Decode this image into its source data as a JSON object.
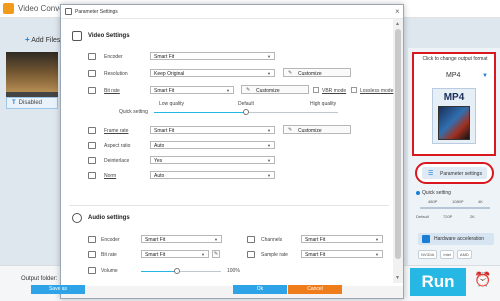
{
  "app": {
    "title": "Video Conve",
    "add_files": "Add Files",
    "subtitle_state": "Disabled",
    "output_folder_label": "Output folder:",
    "run_label": "Run"
  },
  "format_panel": {
    "hint": "Click to change output format",
    "format_name": "MP4",
    "format_icon_text": "MP4",
    "parameter_settings_label": "Parameter settings",
    "quick_setting_label": "Quick setting",
    "quick_top_labels": [
      "480P",
      "1080P",
      "4K"
    ],
    "quick_bottom_labels": [
      "Default",
      "720P",
      "2K"
    ],
    "hardware_accel_label": "Hardware acceleration",
    "vendors": [
      "NVIDIA",
      "Intel",
      "AMD"
    ],
    "accent_color": "#26b7e4",
    "highlight_color": "#d9171e"
  },
  "dialog": {
    "title": "Parameter Settings",
    "video_section": "Video Settings",
    "audio_section": "Audio settings",
    "video": {
      "encoder": {
        "label": "Encoder",
        "value": "Smart Fit"
      },
      "resolution": {
        "label": "Resolution",
        "value": "Keep Original",
        "button": "Customize"
      },
      "bitrate": {
        "label": "Bit rate",
        "value": "Smart Fit",
        "button": "Customize",
        "vbr_label": "VBR mode",
        "lossless_label": "Lossless mode"
      },
      "quality": {
        "low": "Low quality",
        "default": "Default",
        "high": "High quality",
        "quick": "Quick setting",
        "level": 0.5
      },
      "framerate": {
        "label": "Frame rate",
        "value": "Smart Fit",
        "button": "Customize"
      },
      "aspect": {
        "label": "Aspect ratio",
        "value": "Auto"
      },
      "deinterlace": {
        "label": "Deinterlace",
        "value": "Yes"
      },
      "norm": {
        "label": "Norm",
        "value": "Auto"
      }
    },
    "audio": {
      "encoder": {
        "label": "Encoder",
        "value": "Smart Fit"
      },
      "channels": {
        "label": "Channels",
        "value": "Smart Fit"
      },
      "bitrate": {
        "label": "Bit rate",
        "value": "Smart Fit"
      },
      "samplerate": {
        "label": "Sample rate",
        "value": "Smart Fit"
      },
      "volume": {
        "label": "Volume",
        "value": "100%",
        "level": 0.45
      }
    },
    "buttons": {
      "save_as": "Save as",
      "ok": "Ok",
      "cancel": "Cancel"
    }
  }
}
